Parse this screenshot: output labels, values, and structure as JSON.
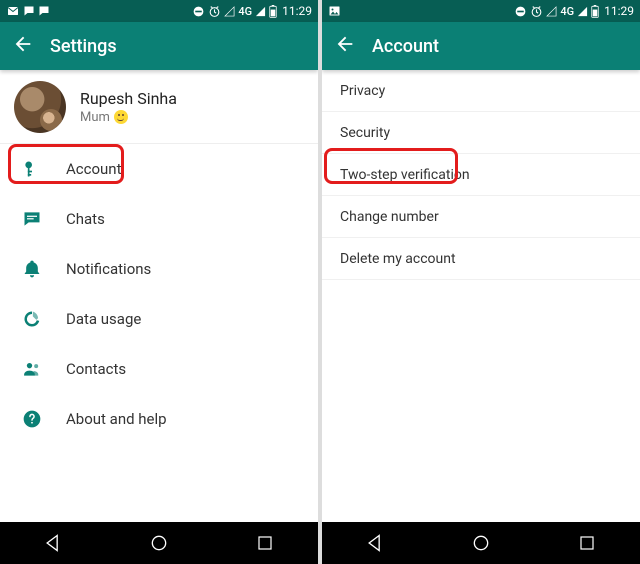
{
  "status": {
    "network_label": "4G",
    "time": "11:29"
  },
  "left": {
    "title": "Settings",
    "profile": {
      "name": "Rupesh Sinha",
      "status_text": "Mum"
    },
    "items": [
      {
        "label": "Account"
      },
      {
        "label": "Chats"
      },
      {
        "label": "Notifications"
      },
      {
        "label": "Data usage"
      },
      {
        "label": "Contacts"
      },
      {
        "label": "About and help"
      }
    ]
  },
  "right": {
    "title": "Account",
    "items": [
      {
        "label": "Privacy"
      },
      {
        "label": "Security"
      },
      {
        "label": "Two-step verification"
      },
      {
        "label": "Change number"
      },
      {
        "label": "Delete my account"
      }
    ]
  }
}
